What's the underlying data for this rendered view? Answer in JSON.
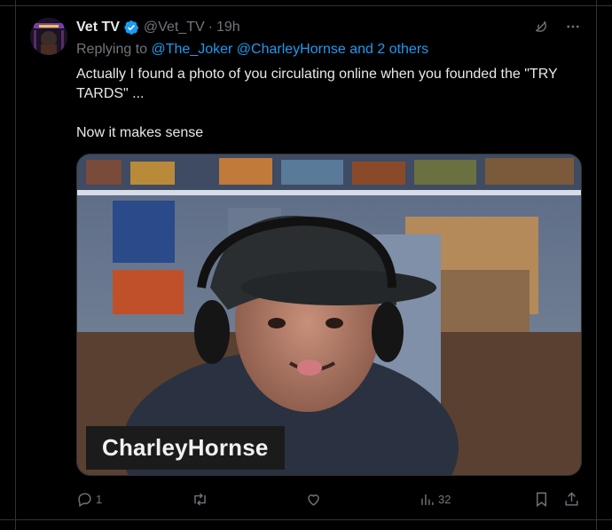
{
  "tweet": {
    "author_name": "Vet TV",
    "author_handle": "@Vet_TV",
    "separator": "·",
    "time": "19h",
    "replying_prefix": "Replying to",
    "mentions": [
      "@The_Joker",
      "@CharleyHornse"
    ],
    "and_others": "and 2 others",
    "text": "Actually I found a photo of you circulating online when you founded the \"TRY TARDS\" ...\n\nNow it makes sense",
    "media_caption": "CharleyHornse"
  },
  "actions": {
    "reply_count": "1",
    "retweet_count": "",
    "like_count": "",
    "views_count": "32"
  },
  "icons": {
    "verified": "verified-badge-icon",
    "grok": "grok-icon",
    "more": "more-icon",
    "reply": "reply-icon",
    "retweet": "retweet-icon",
    "like": "heart-icon",
    "views": "views-icon",
    "bookmark": "bookmark-icon",
    "share": "share-icon"
  },
  "colors": {
    "background": "#000000",
    "text": "#e7e9ea",
    "muted": "#71767b",
    "accent": "#1d9bf0",
    "border": "#2f3336"
  }
}
